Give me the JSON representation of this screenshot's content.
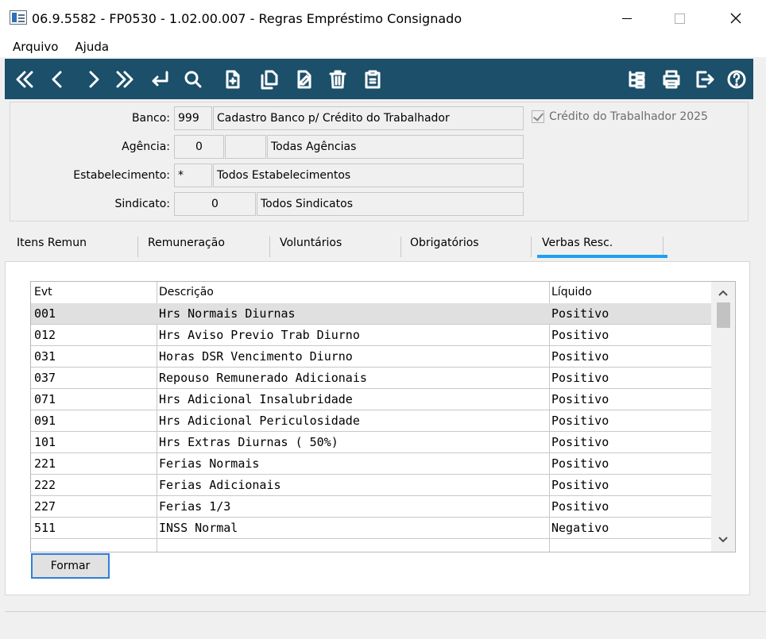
{
  "window": {
    "title": "06.9.5582 - FP0530 - 1.02.00.007 - Regras Empréstimo Consignado"
  },
  "menu": {
    "items": [
      {
        "label": "Arquivo"
      },
      {
        "label": "Ajuda"
      }
    ]
  },
  "toolbar": {
    "color": "#1b4f6a",
    "left_buttons": [
      "first-icon",
      "previous-icon",
      "next-icon",
      "last-icon",
      "return-icon",
      "search-icon",
      "new-document-icon",
      "copy-document-icon",
      "edit-document-icon",
      "delete-icon",
      "paste-document-icon"
    ],
    "right_buttons": [
      "tree-icon",
      "print-icon",
      "exit-icon",
      "help-icon"
    ]
  },
  "form": {
    "banco": {
      "label": "Banco:",
      "code": "999",
      "description": "Cadastro Banco p/ Crédito do Trabalhador"
    },
    "agencia": {
      "label": "Agência:",
      "code": "0",
      "extra": "",
      "description": "Todas Agências"
    },
    "estabelecimento": {
      "label": "Estabelecimento:",
      "code": "*",
      "description": "Todos Estabelecimentos"
    },
    "sindicato": {
      "label": "Sindicato:",
      "code": "0",
      "description": "Todos Sindicatos"
    },
    "credito_trabalhador": {
      "label": "Crédito do Trabalhador 2025",
      "checked": true
    }
  },
  "tabs": [
    {
      "label": "Itens Remun"
    },
    {
      "label": "Remuneração"
    },
    {
      "label": "Voluntários"
    },
    {
      "label": "Obrigatórios"
    },
    {
      "label": "Verbas Resc.",
      "active": true
    }
  ],
  "grid": {
    "columns": [
      "Evt",
      "Descrição",
      "Líquido"
    ],
    "rows": [
      {
        "evt": "001",
        "descricao": "Hrs Normais Diurnas",
        "liquido": "Positivo"
      },
      {
        "evt": "012",
        "descricao": "Hrs Aviso Previo Trab Diurno",
        "liquido": "Positivo"
      },
      {
        "evt": "031",
        "descricao": "Horas DSR Vencimento Diurno",
        "liquido": "Positivo"
      },
      {
        "evt": "037",
        "descricao": "Repouso Remunerado Adicionais",
        "liquido": "Positivo"
      },
      {
        "evt": "071",
        "descricao": "Hrs Adicional Insalubridade",
        "liquido": "Positivo"
      },
      {
        "evt": "091",
        "descricao": "Hrs Adicional Periculosidade",
        "liquido": "Positivo"
      },
      {
        "evt": "101",
        "descricao": "Hrs Extras Diurnas ( 50%)",
        "liquido": "Positivo"
      },
      {
        "evt": "221",
        "descricao": "Ferias Normais",
        "liquido": "Positivo"
      },
      {
        "evt": "222",
        "descricao": "Ferias Adicionais",
        "liquido": "Positivo"
      },
      {
        "evt": "227",
        "descricao": "Ferias 1/3",
        "liquido": "Positivo"
      },
      {
        "evt": "511",
        "descricao": "INSS Normal",
        "liquido": "Negativo"
      },
      {
        "evt": "",
        "descricao": "",
        "liquido": ""
      }
    ]
  },
  "buttons": {
    "formar": "Formar"
  }
}
